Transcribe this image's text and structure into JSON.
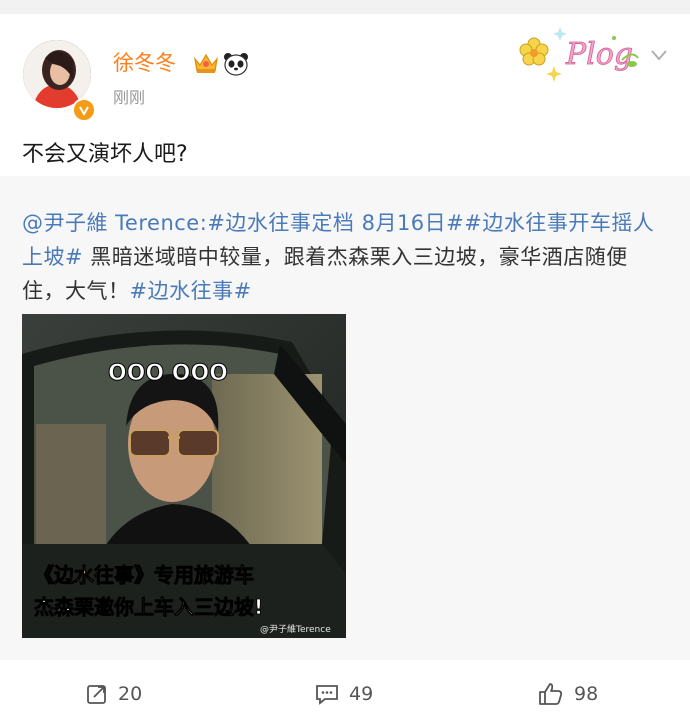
{
  "post": {
    "username": "徐冬冬",
    "timestamp": "刚刚",
    "text": "不会又演坏人吧?",
    "header_icons": [
      "crown-icon",
      "panda-icon"
    ],
    "decoration_text": "Plog"
  },
  "repost": {
    "segments": [
      {
        "text": "@尹子維 Terence:",
        "type": "link"
      },
      {
        "text": "#边水往事定档 8月16日#",
        "type": "link"
      },
      {
        "text": "#边水往事开车摇人上坡#",
        "type": "link"
      },
      {
        "text": " 黑暗迷域暗中较量，跟着杰森栗入三边坡，豪华酒店随便住，大气！",
        "type": "text"
      },
      {
        "text": "#边水往事#",
        "type": "link"
      }
    ],
    "image": {
      "dots": "OOO OOO",
      "caption_line1": "《边水往事》专用旅游车",
      "caption_line2": "杰森栗邀你上车入三边坡!",
      "watermark": "@尹子維Terence"
    }
  },
  "actions": {
    "repost_count": "20",
    "comment_count": "49",
    "like_count": "98"
  },
  "colors": {
    "username": "#ff7e1a",
    "link": "#4a7bb8",
    "caption_yellow": "#ffd21f"
  }
}
